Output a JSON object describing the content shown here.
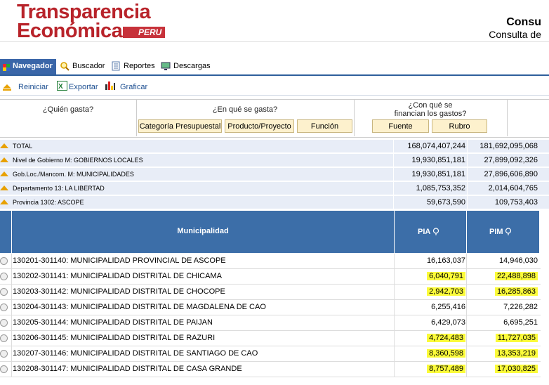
{
  "header": {
    "logo_line1": "Transparencia",
    "logo_line2": "Económica",
    "logo_badge": "PERU",
    "title": "Consu",
    "subtitle": "Consulta de"
  },
  "tabs": [
    {
      "label": "Navegador",
      "active": true,
      "icon": "navigator-cube-icon"
    },
    {
      "label": "Buscador",
      "active": false,
      "icon": "magnifier-icon"
    },
    {
      "label": "Reportes",
      "active": false,
      "icon": "document-icon"
    },
    {
      "label": "Descargas",
      "active": false,
      "icon": "download-monitor-icon"
    }
  ],
  "toolbar": {
    "reiniciar": "Reiniciar",
    "exportar": "Exportar",
    "graficar": "Graficar"
  },
  "questions": {
    "quien": "¿Quién gasta?",
    "en_que": "¿En qué se gasta?",
    "con_que_line1": "¿Con qué se",
    "con_que_line2": "financian los gastos?",
    "buttons": {
      "categoria": "Categoría Presupuestal",
      "producto": "Producto/Proyecto",
      "funcion": "Función",
      "fuente": "Fuente",
      "rubro": "Rubro"
    }
  },
  "summary_rows": [
    {
      "label": "TOTAL",
      "pia": "168,074,407,244",
      "pim": "181,692,095,068"
    },
    {
      "label": "Nivel de Gobierno M: GOBIERNOS LOCALES",
      "pia": "19,930,851,181",
      "pim": "27,899,092,326"
    },
    {
      "label": "Gob.Loc./Mancom. M: MUNICIPALIDADES",
      "pia": "19,930,851,181",
      "pim": "27,896,606,890"
    },
    {
      "label": "Departamento 13: LA LIBERTAD",
      "pia": "1,085,753,352",
      "pim": "2,014,604,765"
    },
    {
      "label": "Provincia 1302: ASCOPE",
      "pia": "59,673,590",
      "pim": "109,753,403"
    }
  ],
  "table": {
    "headers": {
      "name": "Municipalidad",
      "pia": "PIA",
      "pim": "PIM"
    },
    "highlight_color": "#fbfb3a",
    "rows": [
      {
        "name": "130201-301140: MUNICIPALIDAD PROVINCIAL DE ASCOPE",
        "pia": "16,163,037",
        "pim": "14,946,030",
        "highlight": false
      },
      {
        "name": "130202-301141: MUNICIPALIDAD DISTRITAL DE CHICAMA",
        "pia": "6,040,791",
        "pim": "22,488,898",
        "highlight": true
      },
      {
        "name": "130203-301142: MUNICIPALIDAD DISTRITAL DE CHOCOPE",
        "pia": "2,942,703",
        "pim": "16,285,863",
        "highlight": true
      },
      {
        "name": "130204-301143: MUNICIPALIDAD DISTRITAL DE MAGDALENA DE CAO",
        "pia": "6,255,416",
        "pim": "7,226,282",
        "highlight": false
      },
      {
        "name": "130205-301144: MUNICIPALIDAD DISTRITAL DE PAIJAN",
        "pia": "6,429,073",
        "pim": "6,695,251",
        "highlight": false
      },
      {
        "name": "130206-301145: MUNICIPALIDAD DISTRITAL DE RAZURI",
        "pia": "4,724,483",
        "pim": "11,727,035",
        "highlight": true
      },
      {
        "name": "130207-301146: MUNICIPALIDAD DISTRITAL DE SANTIAGO DE CAO",
        "pia": "8,360,598",
        "pim": "13,353,219",
        "highlight": true
      },
      {
        "name": "130208-301147: MUNICIPALIDAD DISTRITAL DE CASA GRANDE",
        "pia": "8,757,489",
        "pim": "17,030,825",
        "highlight": true
      }
    ]
  },
  "colors": {
    "brand_red": "#b8232a",
    "header_blue": "#3c6ea8",
    "summary_bg": "#e8edf7",
    "button_bg": "#fdf1cd"
  }
}
